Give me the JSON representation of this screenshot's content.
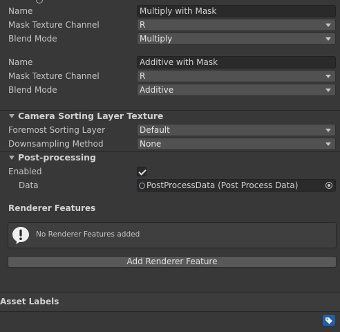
{
  "layers": [
    {
      "name_label": "Name",
      "name_value": "Multiply with Mask",
      "mask_channel_label": "Mask Texture Channel",
      "mask_channel_value": "R",
      "blend_mode_label": "Blend Mode",
      "blend_mode_value": "Multiply"
    },
    {
      "name_label": "Name",
      "name_value": "Additive with Mask",
      "mask_channel_label": "Mask Texture Channel",
      "mask_channel_value": "R",
      "blend_mode_label": "Blend Mode",
      "blend_mode_value": "Additive"
    }
  ],
  "camera_sorting": {
    "header": "Camera Sorting Layer Texture",
    "foremost_label": "Foremost Sorting Layer",
    "foremost_value": "Default",
    "downsampling_label": "Downsampling Method",
    "downsampling_value": "None"
  },
  "post_processing": {
    "header": "Post-processing",
    "enabled_label": "Enabled",
    "enabled_checked": true,
    "data_label": "Data",
    "data_value": "PostProcessData (Post Process Data)"
  },
  "renderer_features": {
    "header": "Renderer Features",
    "empty_message": "No Renderer Features added",
    "add_button_label": "Add Renderer Feature"
  },
  "asset_labels": {
    "header": "Asset Labels"
  },
  "colors": {
    "background": "#383838",
    "field_background": "#2a2a2a",
    "dropdown_background": "#515151",
    "label_icon": "#1f5fa8"
  }
}
